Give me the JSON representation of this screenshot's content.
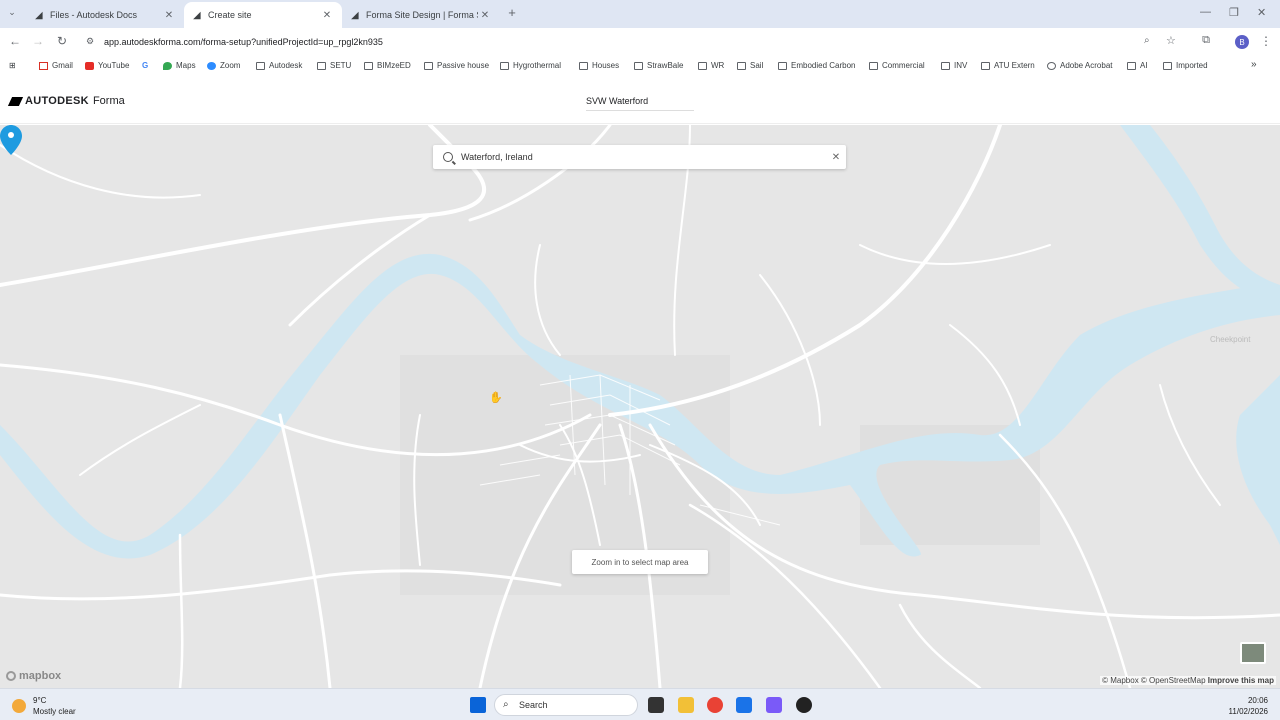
{
  "browser": {
    "tabs": [
      {
        "title": "Files - Autodesk Docs",
        "active": false
      },
      {
        "title": "Create site",
        "active": true
      },
      {
        "title": "Forma Site Design | Forma Site",
        "active": false
      }
    ],
    "new_tab": "+",
    "url": "app.autodeskforma.com/forma-setup?unifiedProjectId=up_rpgl2kn935",
    "profile_initial": "B"
  },
  "bookmarks": [
    {
      "label": "Gmail",
      "icon": "gmail-icon"
    },
    {
      "label": "YouTube",
      "icon": "youtube-icon"
    },
    {
      "label": "",
      "icon": "google-icon"
    },
    {
      "label": "Maps",
      "icon": "maps-icon"
    },
    {
      "label": "Zoom",
      "icon": "zoom-icon"
    },
    {
      "label": "Autodesk",
      "icon": "folder-icon"
    },
    {
      "label": "SETU",
      "icon": "folder-icon"
    },
    {
      "label": "BIMzeED",
      "icon": "folder-icon"
    },
    {
      "label": "Passive house",
      "icon": "folder-icon"
    },
    {
      "label": "Hygrothermal",
      "icon": "folder-icon"
    },
    {
      "label": "Houses",
      "icon": "folder-icon"
    },
    {
      "label": "StrawBale",
      "icon": "folder-icon"
    },
    {
      "label": "WR",
      "icon": "folder-icon"
    },
    {
      "label": "Sail",
      "icon": "folder-icon"
    },
    {
      "label": "Embodied Carbon",
      "icon": "folder-icon"
    },
    {
      "label": "Commercial",
      "icon": "folder-icon"
    },
    {
      "label": "INV",
      "icon": "folder-icon"
    },
    {
      "label": "ATU Extern",
      "icon": "folder-icon"
    },
    {
      "label": "Adobe Acrobat",
      "icon": "globe-icon"
    },
    {
      "label": "AI",
      "icon": "folder-icon"
    },
    {
      "label": "Imported",
      "icon": "folder-icon"
    }
  ],
  "app": {
    "brand_bold": "AUTODESK",
    "brand_product": "Forma",
    "project_name": "SVW Waterford"
  },
  "map": {
    "search_value": "Waterford, Ireland",
    "hint": "Zoom in to select map area",
    "place_label": "Cheekpoint",
    "logo": "mapbox",
    "attribution_1": "© Mapbox",
    "attribution_2": "© OpenStreetMap",
    "attribution_link": "Improve this map"
  },
  "taskbar": {
    "temperature": "9°C",
    "condition": "Mostly clear",
    "search_placeholder": "Search",
    "time": "20:06",
    "date": "11/02/2026"
  },
  "colors": {
    "water": "#cfe7f2",
    "land": "#e4e4e4",
    "road": "#ffffff",
    "pin": "#1e9be0"
  }
}
